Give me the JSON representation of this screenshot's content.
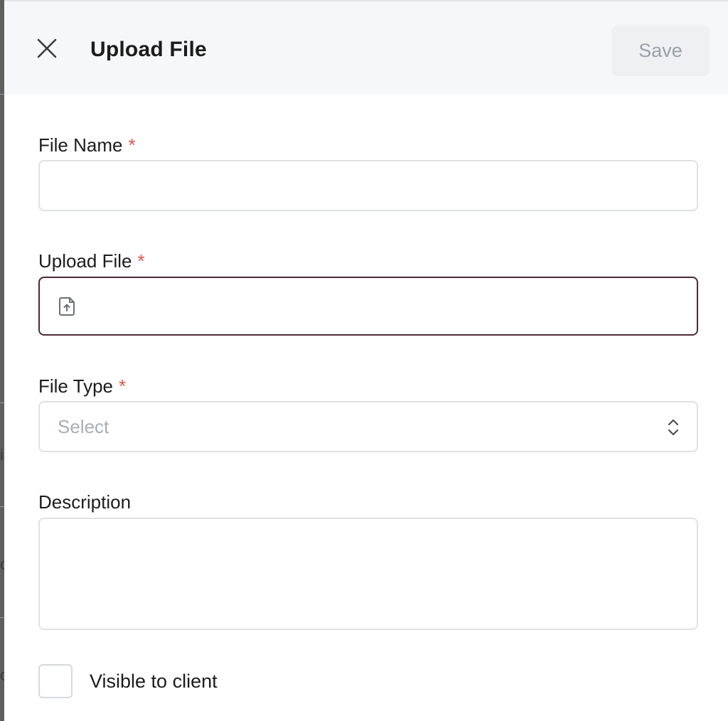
{
  "panel": {
    "title": "Upload File",
    "save_label": "Save",
    "close_icon": "close-icon"
  },
  "fields": {
    "file_name": {
      "label": "File Name",
      "required_mark": "*",
      "value": ""
    },
    "upload_file": {
      "label": "Upload File",
      "required_mark": "*",
      "icon": "file-upload-icon"
    },
    "file_type": {
      "label": "File Type",
      "required_mark": "*",
      "selected": "Select",
      "icon": "chevron-updown-icon"
    },
    "description": {
      "label": "Description",
      "value": ""
    }
  },
  "visible_to_client": {
    "label": "Visible to client",
    "checked": false
  },
  "colors": {
    "header_bg": "#f6f7f8",
    "required": "#e0564a",
    "active_border": "#4a2b33",
    "muted_text": "#9ba1a8"
  }
}
